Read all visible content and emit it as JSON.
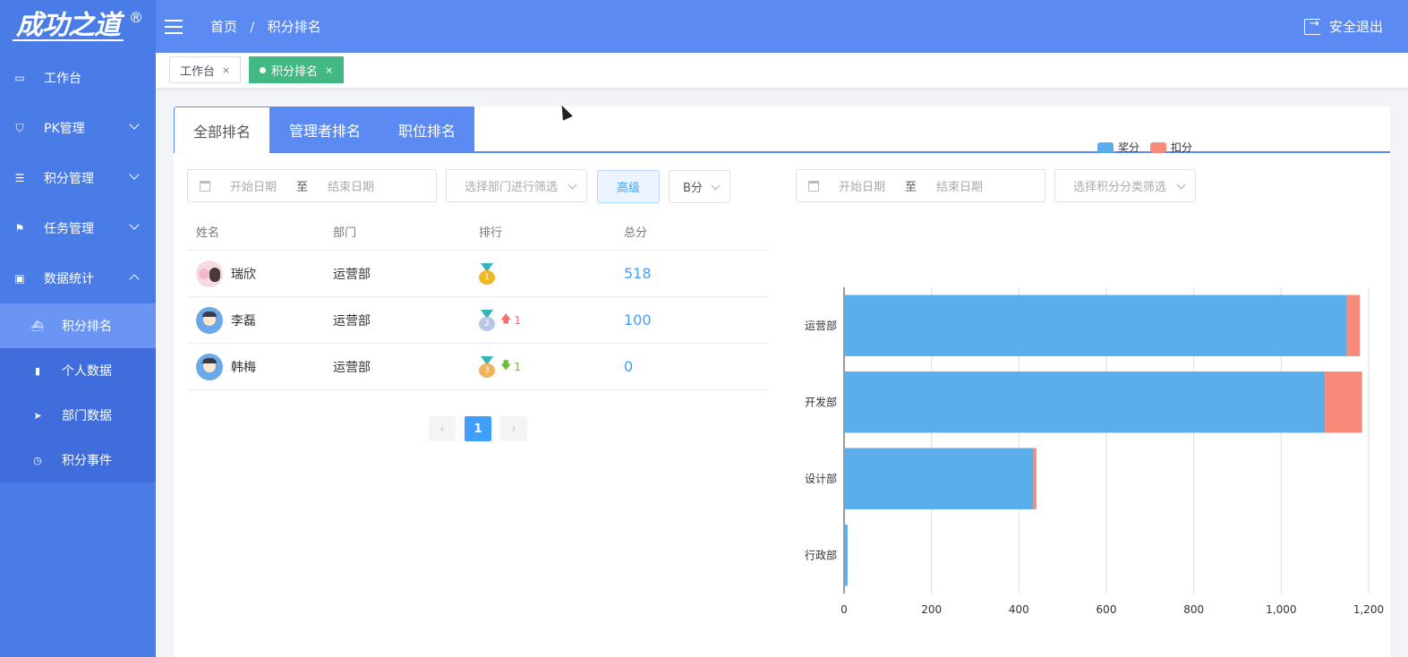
{
  "brand": {
    "logo_text": "成功之道",
    "reg_mark": "®"
  },
  "sidebar": {
    "items": [
      {
        "label": "工作台"
      },
      {
        "label": "PK管理"
      },
      {
        "label": "积分管理"
      },
      {
        "label": "任务管理"
      },
      {
        "label": "数据统计"
      }
    ],
    "sub_items": [
      {
        "label": "积分排名"
      },
      {
        "label": "个人数据"
      },
      {
        "label": "部门数据"
      },
      {
        "label": "积分事件"
      }
    ]
  },
  "header": {
    "breadcrumb": [
      "首页",
      "积分排名"
    ],
    "separator": "/",
    "logout_label": "安全退出"
  },
  "tabs": [
    {
      "label": "工作台",
      "close": "×"
    },
    {
      "label": "积分排名",
      "close": "×"
    }
  ],
  "rank_tabs": [
    "全部排名",
    "管理者排名",
    "职位排名"
  ],
  "filters": {
    "start_placeholder": "开始日期",
    "to": "至",
    "end_placeholder": "结束日期",
    "dept_placeholder": "选择部门进行筛选",
    "advanced_label": "高级",
    "score_type": "B分",
    "category_placeholder": "选择积分分类筛选"
  },
  "table": {
    "headers": [
      "姓名",
      "部门",
      "排行",
      "总分"
    ],
    "rows": [
      {
        "name": "瑞欣",
        "dept": "运营部",
        "rank": "1",
        "trend": "",
        "score": "518"
      },
      {
        "name": "李磊",
        "dept": "运营部",
        "rank": "2",
        "trend": "1",
        "score": "100"
      },
      {
        "name": "韩梅",
        "dept": "运营部",
        "rank": "3",
        "trend": "1",
        "score": "0"
      }
    ]
  },
  "pagination": {
    "current": "1",
    "prev": "‹",
    "next": "›"
  },
  "colors": {
    "reward": "#5aaeec",
    "deduct": "#f88a7a",
    "primary": "#5b8af2",
    "sidebar": "#4a7ce8"
  },
  "chart_data": {
    "type": "bar",
    "orientation": "horizontal",
    "stacked": true,
    "categories": [
      "运营部",
      "开发部",
      "设计部",
      "行政部"
    ],
    "series": [
      {
        "name": "奖分",
        "values": [
          1150,
          1100,
          433,
          8
        ]
      },
      {
        "name": "扣分",
        "values": [
          30,
          85,
          7,
          0
        ]
      }
    ],
    "xlim": [
      0,
      1200
    ],
    "xticks": [
      "0",
      "200",
      "400",
      "600",
      "800",
      "1,000",
      "1,200"
    ],
    "legend": "top-right",
    "grid": true
  }
}
